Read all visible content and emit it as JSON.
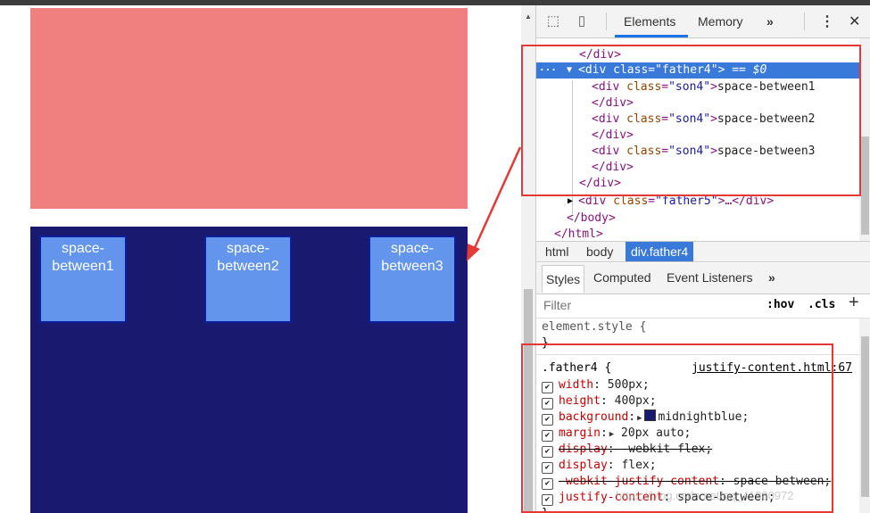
{
  "page": {
    "son4_items": [
      "space-\nbetween1",
      "space-\nbetween2",
      "space-\nbetween3"
    ],
    "colors": {
      "father3_bg": "#f08080",
      "father4_bg": "#191970",
      "son4_bg": "#6495ed"
    }
  },
  "devtools": {
    "toolbar": {
      "inspect_icon": "inspect-cursor-icon",
      "device_icon": "device-toggle-icon",
      "tabs": [
        "Elements",
        "Memory"
      ],
      "more_tabs": "»",
      "menu": "⋮",
      "close": "✕"
    },
    "dom": {
      "line0": "</div>",
      "line1_ellipsis": "···",
      "line1_tag_open": "<div ",
      "line1_attr": "class",
      "line1_val": "\"father4\"",
      "line1_tag_close": ">",
      "line1_suffix": " == $0",
      "son_attr": "class",
      "son_val": "\"son4\"",
      "son_texts": [
        "space-between1",
        "space-between2",
        "space-between3"
      ],
      "close_div": "</div>",
      "div_open": "<div ",
      "father5_val": "\"father5\"",
      "collapsed_tail": ">…</div>",
      "body_close": "</body>",
      "html_close": "</html>"
    },
    "breadcrumb": [
      "html",
      "body",
      "div.father4"
    ],
    "styles_tabs": [
      "Styles",
      "Computed",
      "Event Listeners",
      "»"
    ],
    "filter": {
      "placeholder": "Filter",
      "hov": ":hov",
      "cls": ".cls",
      "add": "+"
    },
    "element_style": {
      "selector": "element.style {",
      "close": "}"
    },
    "rule": {
      "selector": ".father4 {",
      "source": "justify-content.html:67",
      "declarations": [
        {
          "prop": "width",
          "value": "500px;",
          "struck": false
        },
        {
          "prop": "height",
          "value": "400px;",
          "struck": false
        },
        {
          "prop": "background",
          "value": "midnightblue;",
          "struck": false,
          "swatch": "#191970"
        },
        {
          "prop": "margin",
          "value": "20px auto;",
          "struck": false
        },
        {
          "prop": "display",
          "value": "-webkit-flex;",
          "struck": true
        },
        {
          "prop": "display",
          "value": "flex;",
          "struck": false
        },
        {
          "prop": "-webkit-justify-content",
          "value": "space-between;",
          "struck": true
        },
        {
          "prop": "justify-content",
          "value": "space-between;",
          "struck": false
        }
      ]
    },
    "watermark": "https://blog.csdn.net/qq_41380972"
  }
}
